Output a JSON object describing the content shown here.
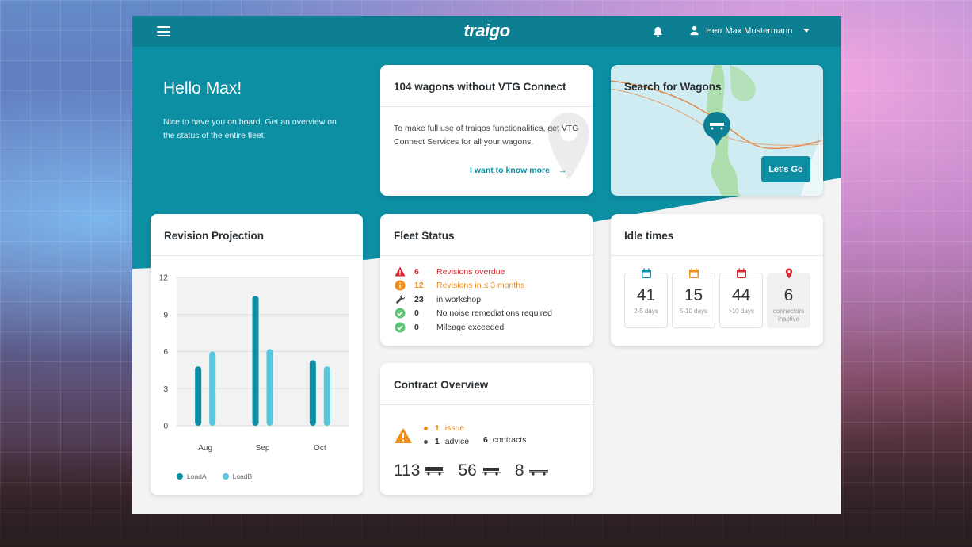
{
  "header": {
    "logo": "traigo",
    "user_name": "Herr Max Mustermann"
  },
  "hero": {
    "greeting": "Hello Max!",
    "subtitle": "Nice to have you on board. Get an overview on the status of the entire fleet."
  },
  "vtg_card": {
    "title": "104 wagons without VTG Connect",
    "body": "To make full use of traigos functionalities, get VTG Connect Services for all your wagons.",
    "link": "I want to know more"
  },
  "search_card": {
    "title": "Search for Wagons",
    "button": "Let's Go"
  },
  "revision": {
    "title": "Revision Projection"
  },
  "chart_data": {
    "type": "bar",
    "title": "Revision Projection",
    "categories": [
      "Aug",
      "Sep",
      "Oct"
    ],
    "series": [
      {
        "name": "LoadA",
        "values": [
          4.8,
          10.5,
          5.3
        ],
        "color": "#0c8ea3"
      },
      {
        "name": "LoadB",
        "values": [
          6.0,
          6.2,
          4.8
        ],
        "color": "#56c7dc"
      }
    ],
    "yticks": [
      "12",
      "9",
      "6",
      "3",
      "0"
    ],
    "ylim": [
      0,
      12
    ],
    "grid": true,
    "legend": "bottom"
  },
  "fleet": {
    "title": "Fleet Status",
    "rows": [
      {
        "icon": "warning-triangle-icon",
        "num": "6",
        "label": "Revisions overdue",
        "color": "red"
      },
      {
        "icon": "info-circle-icon",
        "num": "12",
        "label": "Revisions in ≤ 3 months",
        "color": "orange"
      },
      {
        "icon": "wrench-icon",
        "num": "23",
        "label": "in workshop",
        "color": "default"
      },
      {
        "icon": "check-circle-icon",
        "num": "0",
        "label": "No noise remediations required",
        "color": "default"
      },
      {
        "icon": "check-circle-icon",
        "num": "0",
        "label": "Mileage exceeded",
        "color": "default"
      }
    ]
  },
  "idle": {
    "title": "Idle times",
    "boxes": [
      {
        "value": "41",
        "label": "2-5 days",
        "icon_color": "#0c8ea3"
      },
      {
        "value": "15",
        "label": "5-10 days",
        "icon_color": "#ef8c1a"
      },
      {
        "value": "44",
        "label": ">10 days",
        "icon_color": "#d7262d"
      },
      {
        "value": "6",
        "label": "connectors inactive",
        "icon_color": "#d7262d"
      }
    ]
  },
  "contract": {
    "title": "Contract Overview",
    "issue_num": "1",
    "issue_label": "issue",
    "advice_num": "1",
    "advice_label": "advice",
    "contracts_num": "6",
    "contracts_label": "contracts",
    "wagon_counts": [
      "113",
      "56",
      "8"
    ]
  }
}
